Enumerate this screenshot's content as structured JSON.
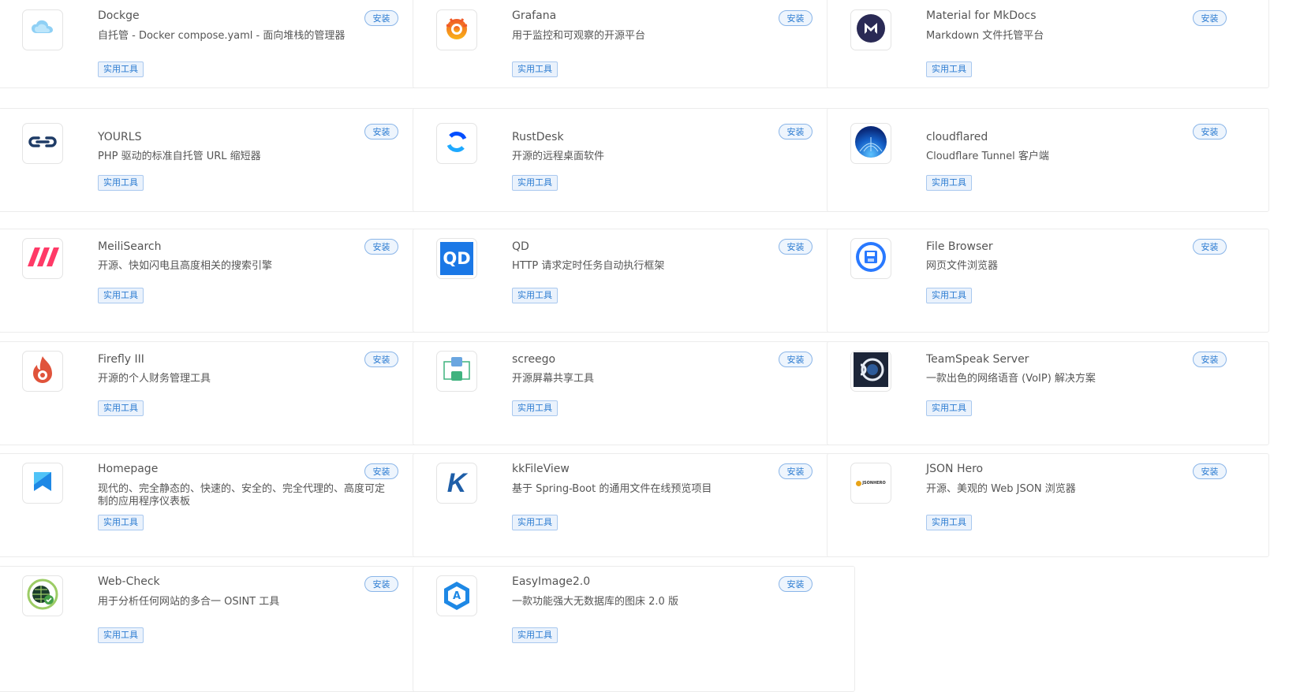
{
  "apps": [
    {
      "name": "Dockge",
      "desc": "自托管 - Docker compose.yaml - 面向堆栈的管理器",
      "install": "安装",
      "tag": "实用工具",
      "icon": "dockge-icon"
    },
    {
      "name": "Grafana",
      "desc": "用于监控和可观察的开源平台",
      "install": "安装",
      "tag": "实用工具",
      "icon": "grafana-icon"
    },
    {
      "name": "Material for MkDocs",
      "desc": "Markdown 文件托管平台",
      "install": "安装",
      "tag": "实用工具",
      "icon": "mkdocs-icon"
    },
    {
      "name": "YOURLS",
      "desc": "PHP 驱动的标准自托管 URL 缩短器",
      "install": "安装",
      "tag": "实用工具",
      "icon": "link-icon"
    },
    {
      "name": "RustDesk",
      "desc": "开源的远程桌面软件",
      "install": "安装",
      "tag": "实用工具",
      "icon": "rustdesk-icon"
    },
    {
      "name": "cloudflared",
      "desc": "Cloudflare Tunnel 客户端",
      "install": "安装",
      "tag": "实用工具",
      "icon": "cloudflared-icon"
    },
    {
      "name": "MeiliSearch",
      "desc": "开源、快如闪电且高度相关的搜索引擎",
      "install": "安装",
      "tag": "实用工具",
      "icon": "meilisearch-icon"
    },
    {
      "name": "QD",
      "desc": "HTTP 请求定时任务自动执行框架",
      "install": "安装",
      "tag": "实用工具",
      "icon": "qd-icon",
      "icon_text": "QD"
    },
    {
      "name": "File Browser",
      "desc": "网页文件浏览器",
      "install": "安装",
      "tag": "实用工具",
      "icon": "filebrowser-icon"
    },
    {
      "name": "Firefly III",
      "desc": "开源的个人财务管理工具",
      "install": "安装",
      "tag": "实用工具",
      "icon": "firefly-icon"
    },
    {
      "name": "screego",
      "desc": "开源屏幕共享工具",
      "install": "安装",
      "tag": "实用工具",
      "icon": "screego-icon"
    },
    {
      "name": "TeamSpeak Server",
      "desc": "一款出色的网络语音 (VoIP) 解决方案",
      "install": "安装",
      "tag": "实用工具",
      "icon": "teamspeak-icon"
    },
    {
      "name": "Homepage",
      "desc": "现代的、完全静态的、快速的、安全的、完全代理的、高度可定制的应用程序仪表板",
      "install": "安装",
      "tag": "实用工具",
      "icon": "homepage-icon"
    },
    {
      "name": "kkFileView",
      "desc": "基于 Spring-Boot 的通用文件在线预览项目",
      "install": "安装",
      "tag": "实用工具",
      "icon": "kkfileview-icon",
      "icon_text": "K"
    },
    {
      "name": "JSON Hero",
      "desc": "开源、美观的 Web JSON 浏览器",
      "install": "安装",
      "tag": "实用工具",
      "icon": "jsonhero-icon",
      "icon_text": "JSONHERO"
    },
    {
      "name": "Web-Check",
      "desc": "用于分析任何网站的多合一 OSINT 工具",
      "install": "安装",
      "tag": "实用工具",
      "icon": "webcheck-icon"
    },
    {
      "name": "EasyImage2.0",
      "desc": "一款功能强大无数据库的图床 2.0 版",
      "install": "安装",
      "tag": "实用工具",
      "icon": "easyimage-icon",
      "icon_text": "A"
    }
  ]
}
